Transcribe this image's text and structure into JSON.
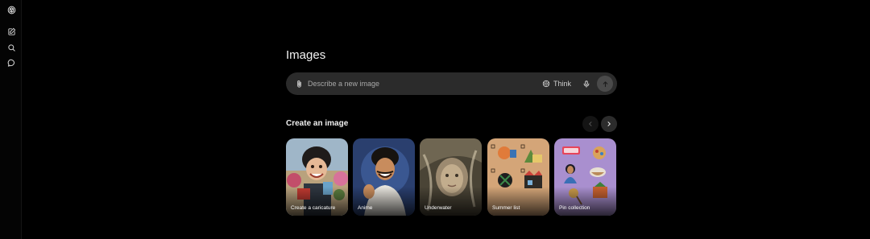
{
  "page": {
    "title": "Images"
  },
  "sidebar": {
    "icons": [
      "openai-logo-icon",
      "new-chat-icon",
      "search-icon",
      "chats-icon"
    ]
  },
  "composer": {
    "placeholder": "Describe a new image",
    "think_label": "Think"
  },
  "gallery": {
    "title": "Create an image",
    "cards": [
      {
        "label": "Create a caricature"
      },
      {
        "label": "Anime"
      },
      {
        "label": "Underwater"
      },
      {
        "label": "Summer list"
      },
      {
        "label": "Pin collection"
      }
    ]
  },
  "colors": {
    "background": "#000000",
    "composer_bg": "#2b2b2b",
    "text": "#ececec",
    "muted": "#a8a8a8",
    "card_anime_bg": "#2a3f6e",
    "card_summer_bg": "#d4a578",
    "card_pin_bg": "#a98fcf"
  }
}
